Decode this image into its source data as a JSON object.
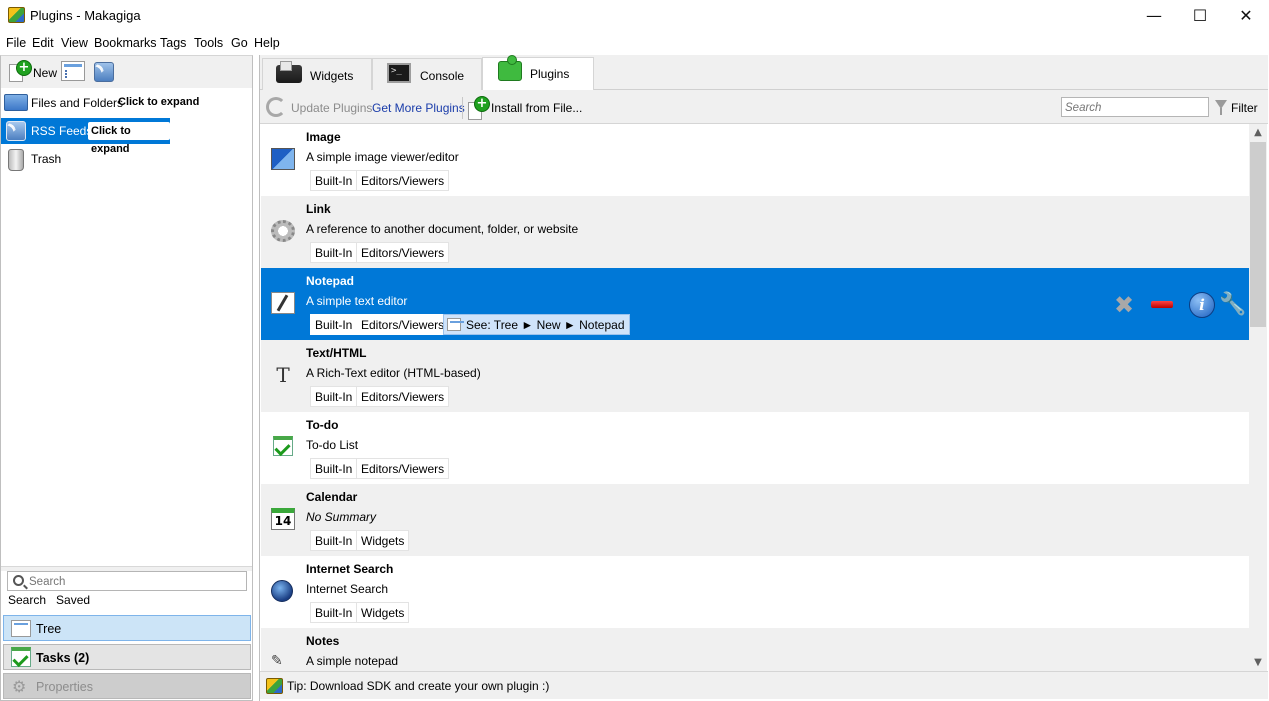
{
  "window": {
    "title": "Plugins - Makagiga",
    "minimize": "—",
    "maximize": "☐",
    "close": "✕"
  },
  "menu": [
    "File",
    "Edit",
    "View",
    "Bookmarks",
    "Tags",
    "Tools",
    "Go",
    "Help"
  ],
  "left_panel": {
    "new_label": "New",
    "tree_items": [
      {
        "label": "Files and Folders",
        "hint": "Click to expand"
      },
      {
        "label": "RSS Feeds",
        "hint": "Click to expand",
        "selected": true
      },
      {
        "label": "Trash"
      }
    ],
    "search_placeholder": "Search",
    "links": [
      "Search",
      "Saved"
    ],
    "nav": [
      {
        "label": "Tree",
        "active": true
      },
      {
        "label": "Tasks (2)"
      },
      {
        "label": "Properties",
        "disabled": true
      }
    ]
  },
  "tabs": [
    {
      "label": "Widgets"
    },
    {
      "label": "Console"
    },
    {
      "label": "Plugins",
      "active": true
    }
  ],
  "plugins_toolbar": {
    "update": "Update Plugins",
    "get_more": "Get More Plugins",
    "install": "Install from File...",
    "search_placeholder": "Search",
    "filter": "Filter"
  },
  "plugins": [
    {
      "name": "Image",
      "description": "A simple image viewer/editor",
      "tags": [
        "Built-In",
        "Editors/Viewers"
      ],
      "icon": "image-icon"
    },
    {
      "name": "Link",
      "description": "A reference to another document, folder, or website",
      "tags": [
        "Built-In",
        "Editors/Viewers"
      ],
      "icon": "gear-icon"
    },
    {
      "name": "Notepad",
      "description": "A simple text editor",
      "tags": [
        "Built-In",
        "Editors/Viewers"
      ],
      "icon": "notepad-icon",
      "selected": true,
      "see": "See: Tree  ►  New  ►  Notepad"
    },
    {
      "name": "Text/HTML",
      "description": "A Rich-Text editor (HTML-based)",
      "tags": [
        "Built-In",
        "Editors/Viewers"
      ],
      "icon": "text-icon",
      "glyph": "T"
    },
    {
      "name": "To-do",
      "description": "To-do List",
      "tags": [
        "Built-In",
        "Editors/Viewers"
      ],
      "icon": "check-icon"
    },
    {
      "name": "Calendar",
      "description": "No Summary",
      "tags": [
        "Built-In",
        "Widgets"
      ],
      "icon": "calendar-icon",
      "glyph": "14",
      "italic": true
    },
    {
      "name": "Internet Search",
      "description": "Internet Search",
      "tags": [
        "Built-In",
        "Widgets"
      ],
      "icon": "globe-icon"
    },
    {
      "name": "Notes",
      "description": "A simple notepad",
      "tags": [],
      "icon": "pencil-icon",
      "glyph": "✎"
    }
  ],
  "row_actions": {
    "remove": "✖",
    "wrench": "🔧",
    "info": "i"
  },
  "scroll": {
    "up": "▲",
    "down": "▼",
    "position": 0
  },
  "status": "Tip: Download SDK and create your own plugin :)",
  "colors": {
    "selection": "#0078d7",
    "link": "#1a3caa",
    "accent_green": "#1fa11f"
  }
}
